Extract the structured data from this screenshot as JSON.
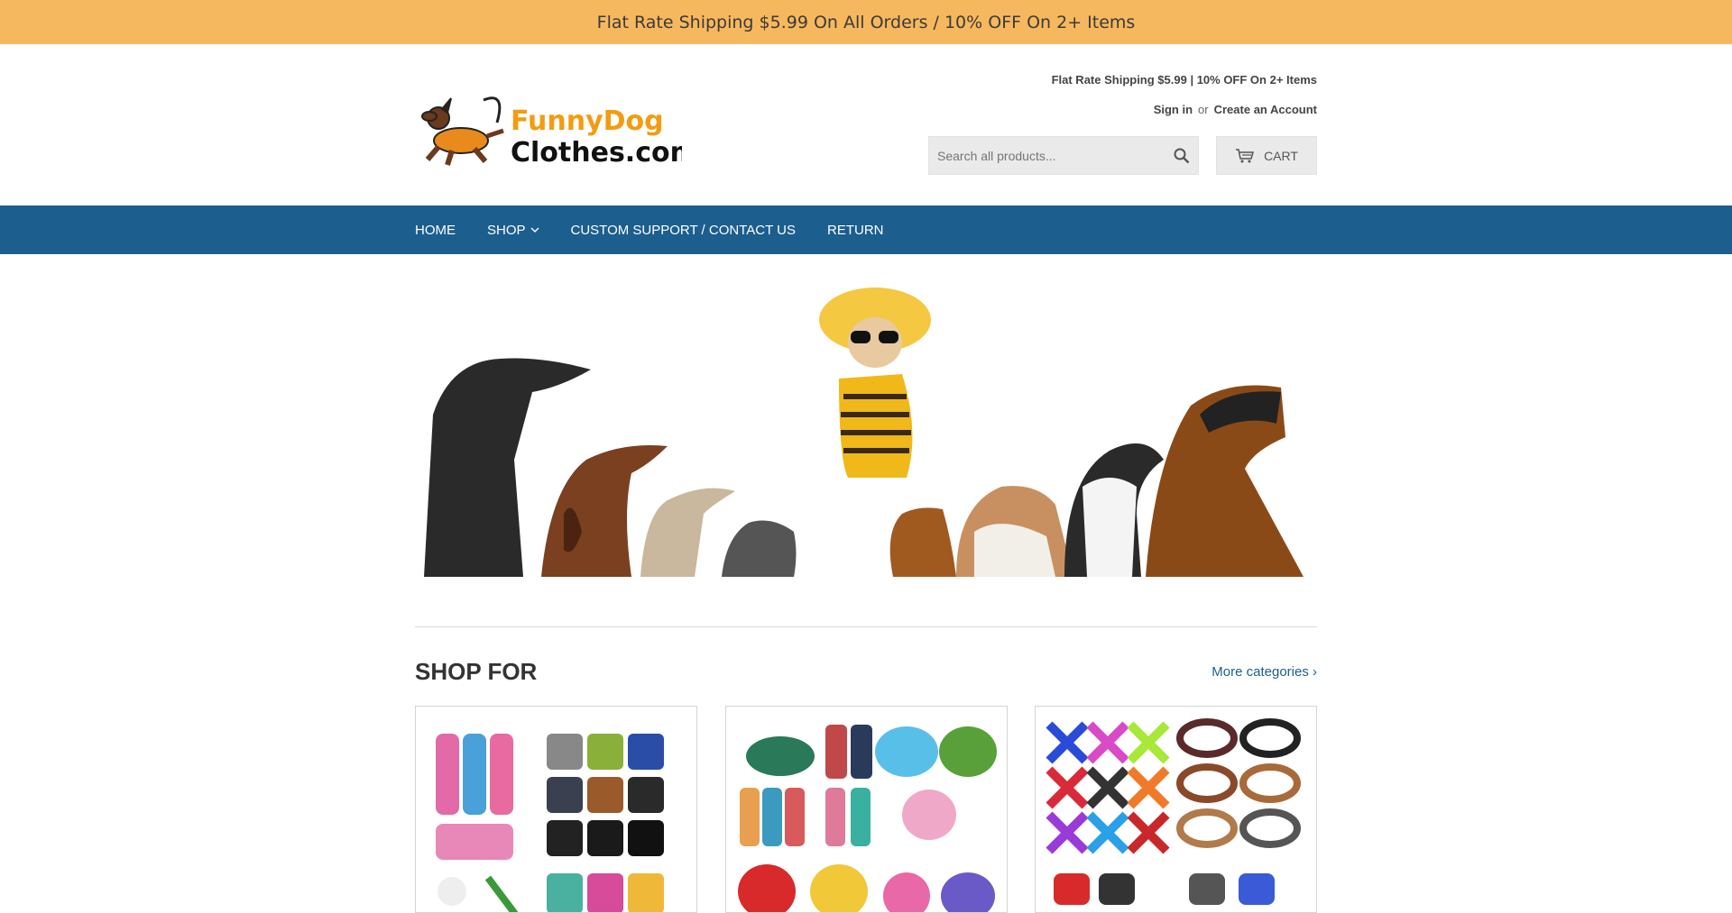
{
  "announcement": "Flat Rate Shipping $5.99 On All Orders / 10% OFF On 2+ Items",
  "header": {
    "logo_alt": "FunnyDog Clothes.com",
    "logo_line1": "FunnyDog",
    "logo_line2": "Clothes.com",
    "note": "Flat Rate Shipping $5.99 | 10% OFF On 2+ Items",
    "sign_in": "Sign in",
    "or": "or",
    "create_account": "Create an Account",
    "search_placeholder": "Search all products...",
    "cart_label": "CART"
  },
  "nav": {
    "home": "HOME",
    "shop": "SHOP",
    "support": "CUSTOM SUPPORT / CONTACT US",
    "return": "RETURN"
  },
  "shop_for": {
    "title": "SHOP FOR",
    "more": "More categories ›"
  },
  "colors": {
    "announce_bg": "#f6b85e",
    "nav_bg": "#1c5e8d",
    "logo_orange": "#f39c12"
  }
}
